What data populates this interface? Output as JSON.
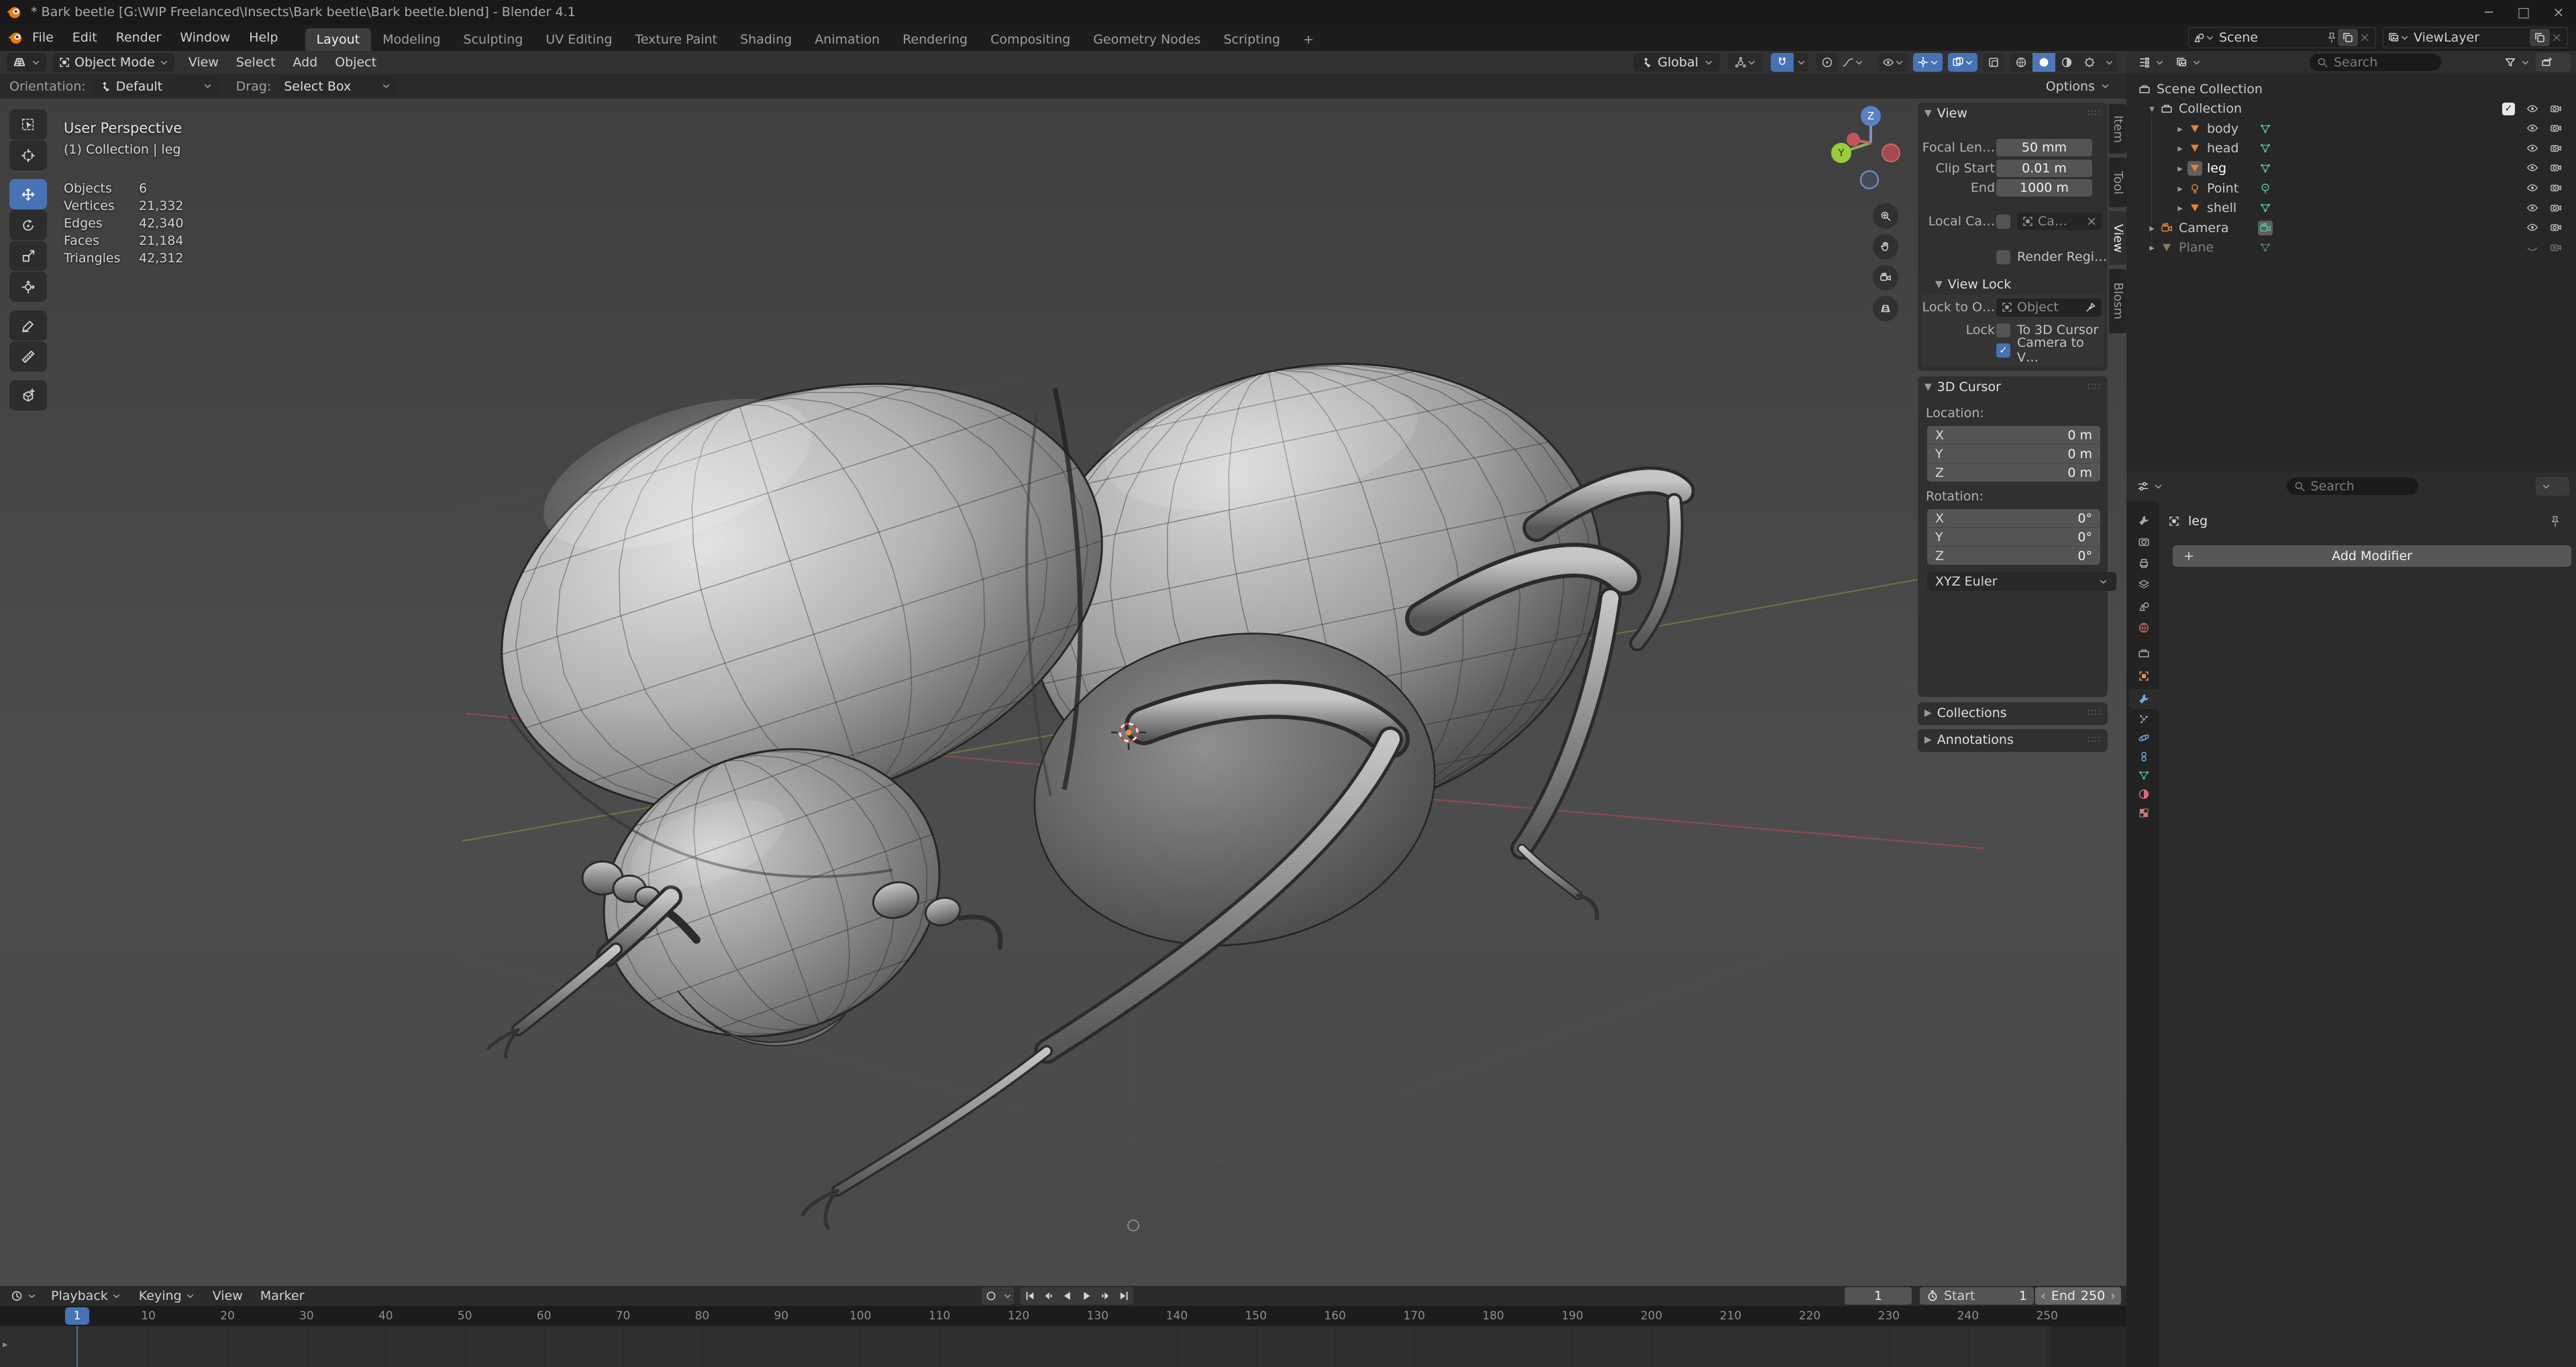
{
  "window": {
    "title": "* Bark beetle [G:\\WIP Freelanced\\Insects\\Bark beetle\\Bark beetle.blend] - Blender 4.1",
    "controls": [
      "minimize",
      "maximize",
      "close"
    ]
  },
  "topbar": {
    "menus": [
      "File",
      "Edit",
      "Render",
      "Window",
      "Help"
    ],
    "workspaces": [
      "Layout",
      "Modeling",
      "Sculpting",
      "UV Editing",
      "Texture Paint",
      "Shading",
      "Animation",
      "Rendering",
      "Compositing",
      "Geometry Nodes",
      "Scripting"
    ],
    "active_workspace": "Layout",
    "add_workspace_label": "+",
    "scene_name": "Scene",
    "viewlayer_name": "ViewLayer"
  },
  "viewport_header": {
    "mode": "Object Mode",
    "menus": [
      "View",
      "Select",
      "Add",
      "Object"
    ],
    "orientation": "Global",
    "shading_modes": [
      "wireframe",
      "solid",
      "material-preview",
      "rendered"
    ],
    "active_shading": "solid"
  },
  "tool_settings": {
    "orientation_label": "Orientation:",
    "orientation_value": "Default",
    "drag_label": "Drag:",
    "drag_value": "Select Box",
    "options_label": "Options"
  },
  "viewport": {
    "perspective_label": "User Perspective",
    "context_label": "(1) Collection | leg",
    "stats": [
      {
        "label": "Objects",
        "value": "6"
      },
      {
        "label": "Vertices",
        "value": "21,332"
      },
      {
        "label": "Edges",
        "value": "42,340"
      },
      {
        "label": "Faces",
        "value": "21,184"
      },
      {
        "label": "Triangles",
        "value": "42,312"
      }
    ],
    "toolbar": [
      "select-box",
      "cursor",
      "move",
      "rotate",
      "scale",
      "transform",
      "annotate",
      "measure",
      "add-cube"
    ],
    "active_tool": "move",
    "nav_buttons": [
      "zoom",
      "pan",
      "camera-view",
      "toggle-ortho"
    ],
    "gizmo_axes": {
      "z": "Z",
      "y": "Y"
    }
  },
  "sidebar": {
    "tabs": [
      "Item",
      "Tool",
      "View",
      "Blosm"
    ],
    "active_tab": "View",
    "view": {
      "title": "View",
      "focal_label": "Focal Len…",
      "focal_value": "50 mm",
      "clip_label": "Clip Start",
      "clip_value": "0.01 m",
      "end_label": "End",
      "end_value": "1000 m",
      "local_camera_label": "Local Ca…",
      "local_camera_value": "Ca…",
      "render_region_label": "Render Regi…"
    },
    "view_lock": {
      "title": "View Lock",
      "lock_object_label": "Lock to O…",
      "lock_object_placeholder": "Object",
      "lock_label": "Lock",
      "to_3d_cursor_label": "To 3D Cursor",
      "camera_to_view_label": "Camera to V…"
    },
    "cursor_3d": {
      "title": "3D Cursor",
      "location_label": "Location:",
      "rotation_label": "Rotation:",
      "axes": [
        "X",
        "Y",
        "Z"
      ],
      "location_values": [
        "0 m",
        "0 m",
        "0 m"
      ],
      "rotation_values": [
        "0°",
        "0°",
        "0°"
      ],
      "euler_mode": "XYZ Euler"
    },
    "collections_title": "Collections",
    "annotations_title": "Annotations"
  },
  "outliner": {
    "search_placeholder": "Search",
    "rows": [
      {
        "label": "Scene Collection",
        "icon": "collection",
        "indent": 0,
        "expander": "",
        "controls": []
      },
      {
        "label": "Collection",
        "icon": "collection",
        "indent": 1,
        "expander": "down",
        "controls": [
          "check",
          "eye",
          "cam"
        ]
      },
      {
        "label": "body",
        "icon": "mesh-obj",
        "data_icon": "mesh-data",
        "indent": 2,
        "expander": "right",
        "controls": [
          "eye",
          "cam"
        ]
      },
      {
        "label": "head",
        "icon": "mesh-obj",
        "data_icon": "mesh-data",
        "indent": 2,
        "expander": "right",
        "controls": [
          "eye",
          "cam"
        ]
      },
      {
        "label": "leg",
        "icon": "mesh-obj",
        "data_icon": "mesh-data",
        "indent": 2,
        "expander": "right",
        "controls": [
          "eye",
          "cam"
        ],
        "active": true
      },
      {
        "label": "Point",
        "icon": "light-obj",
        "data_icon": "light-data",
        "indent": 2,
        "expander": "right",
        "controls": [
          "eye",
          "cam"
        ]
      },
      {
        "label": "shell",
        "icon": "mesh-obj",
        "data_icon": "mesh-data",
        "indent": 2,
        "expander": "right",
        "controls": [
          "eye",
          "cam"
        ]
      },
      {
        "label": "Camera",
        "icon": "camera-obj",
        "data_icon": "camera-data",
        "indent": 1,
        "expander": "right",
        "controls": [
          "eye",
          "cam"
        ],
        "data_active": true
      },
      {
        "label": "Plane",
        "icon": "mesh-obj",
        "data_icon": "mesh-data",
        "indent": 1,
        "expander": "right",
        "controls": [
          "eye-closed",
          "cam-off"
        ],
        "dim": true
      }
    ]
  },
  "properties": {
    "search_placeholder": "Search",
    "breadcrumb": "leg",
    "add_modifier_label": "Add Modifier",
    "tabs": [
      "tool",
      "render",
      "output",
      "view-layer",
      "scene",
      "world",
      "collection",
      "object",
      "modifiers",
      "particles",
      "physics",
      "constraints",
      "object-data",
      "material",
      "texture"
    ],
    "active_tab": "modifiers"
  },
  "timeline": {
    "menus": [
      "Playback",
      "Keying",
      "View",
      "Marker"
    ],
    "playback_buttons": [
      "jump-start",
      "prev-keyframe",
      "play-reverse",
      "play",
      "next-keyframe",
      "jump-end"
    ],
    "current_frame": "1",
    "start_label": "Start",
    "start_value": "1",
    "end_label": "End",
    "end_value": "250",
    "playhead_label": "1",
    "ticks": [
      10,
      20,
      30,
      40,
      50,
      60,
      70,
      80,
      90,
      100,
      110,
      120,
      130,
      140,
      150,
      160,
      170,
      180,
      190,
      200,
      210,
      220,
      230,
      240,
      250
    ]
  },
  "colors": {
    "accent": "#4772b3",
    "object_orange": "#e0833a",
    "data_green": "#4fc0a0",
    "axis_x_red": "#96494f",
    "axis_y_green": "#6d8f3f"
  }
}
